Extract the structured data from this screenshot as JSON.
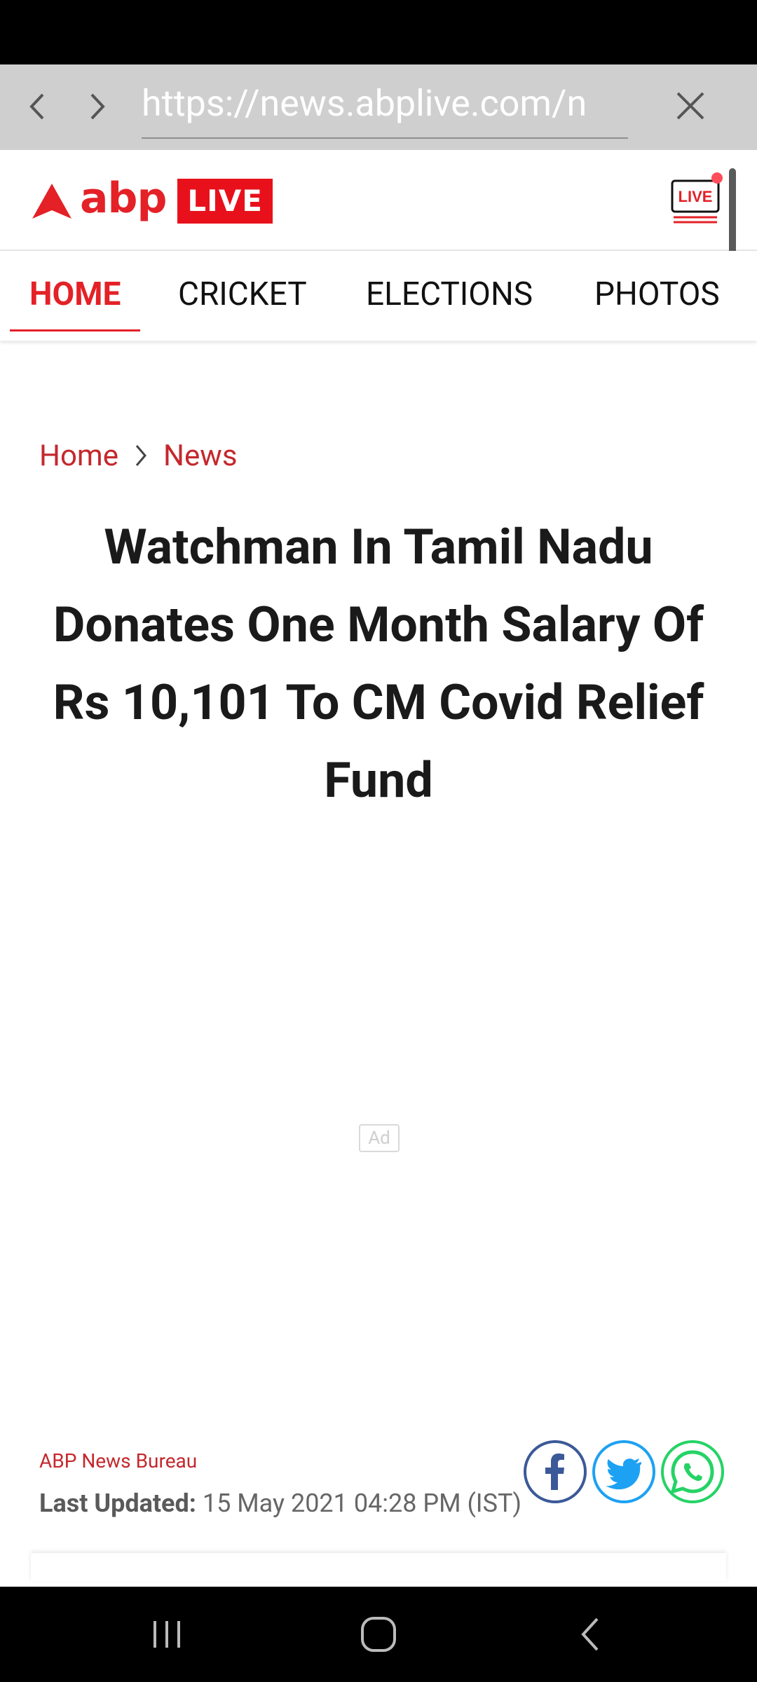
{
  "browser": {
    "url": "https://news.abplive.com/n"
  },
  "header": {
    "logo_text": "abp",
    "logo_badge": "LIVE",
    "live_tv_label": "LIVE"
  },
  "nav": {
    "items": [
      {
        "label": "HOME",
        "active": true
      },
      {
        "label": "CRICKET",
        "active": false
      },
      {
        "label": "ELECTIONS",
        "active": false
      },
      {
        "label": "PHOTOS",
        "active": false
      }
    ]
  },
  "breadcrumb": {
    "home": "Home",
    "current": "News"
  },
  "article": {
    "headline": "Watchman In Tamil Nadu Donates One Month Salary Of Rs 10,101 To CM Covid Relief Fund",
    "ad_label": "Ad",
    "author": "ABP News Bureau",
    "updated_label": "Last Updated:",
    "updated_value": "15 May 2021 04:28 PM (IST)"
  },
  "share": {
    "icons": [
      "facebook-icon",
      "twitter-icon",
      "whatsapp-icon"
    ]
  },
  "colors": {
    "brand_red": "#e32127",
    "breadcrumb_red": "#c4282d",
    "facebook": "#3b5998",
    "twitter": "#1da1f2",
    "whatsapp": "#25d366"
  }
}
